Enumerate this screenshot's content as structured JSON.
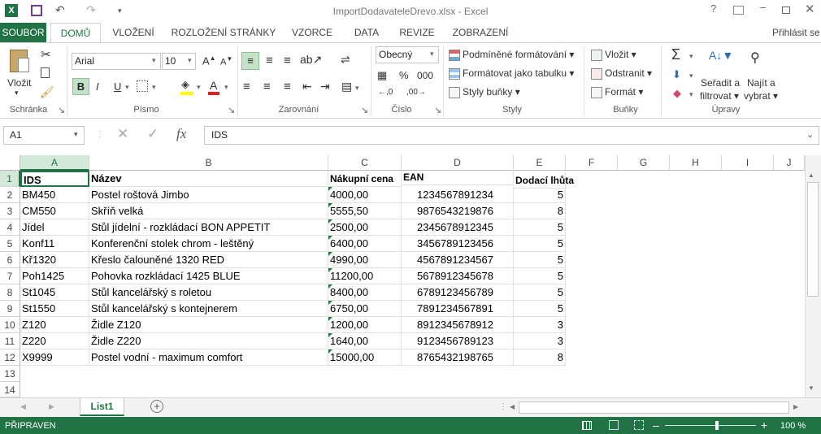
{
  "window": {
    "title": "ImportDodavateleDrevo.xlsx - Excel"
  },
  "qat": {
    "icons": [
      "excel-logo-icon",
      "save-icon",
      "undo-icon",
      "redo-icon",
      "customize-icon"
    ]
  },
  "win_controls": {
    "help": "?"
  },
  "tabs": [
    {
      "label": "SOUBOR"
    },
    {
      "label": "DOMŮ"
    },
    {
      "label": "VLOŽENÍ"
    },
    {
      "label": "ROZLOŽENÍ STRÁNKY"
    },
    {
      "label": "VZORCE"
    },
    {
      "label": "DATA"
    },
    {
      "label": "REVIZE"
    },
    {
      "label": "ZOBRAZENÍ"
    }
  ],
  "signin": "Přihlásit se",
  "ribbon": {
    "clipboard": {
      "paste": "Vložit",
      "label": "Schránka"
    },
    "font": {
      "name": "Arial",
      "size": "10",
      "label": "Písmo",
      "bold": "B",
      "italic": "I",
      "underline": "U"
    },
    "alignment": {
      "label": "Zarovnání"
    },
    "number": {
      "format": "Obecný",
      "label": "Číslo"
    },
    "styles": {
      "conditional": "Podmíněné formátování",
      "table": "Formátovat jako tabulku",
      "cell_styles": "Styly buňky",
      "label": "Styly"
    },
    "cells": {
      "insert": "Vložit",
      "delete": "Odstranit",
      "format": "Formát",
      "label": "Buňky"
    },
    "editing": {
      "sort": "Seřadit a",
      "sort2": "filtrovat",
      "find": "Najít a",
      "find2": "vybrat",
      "label": "Úpravy"
    }
  },
  "formula_bar": {
    "name_box": "A1",
    "value": "IDS",
    "fx": "fx"
  },
  "columns": [
    "A",
    "B",
    "C",
    "D",
    "E",
    "F",
    "G",
    "H",
    "I",
    "J"
  ],
  "headers": {
    "a": "IDS",
    "b": "Název",
    "c": "Nákupní cena",
    "d": "EAN",
    "e": "Dodací lhůta"
  },
  "rows": [
    {
      "n": "2",
      "a": "BM450",
      "b": "Postel roštová Jimbo",
      "c": "4000,00",
      "d": "1234567891234",
      "e": "5"
    },
    {
      "n": "3",
      "a": "CM550",
      "b": "Skříň velká",
      "c": "5555,50",
      "d": "9876543219876",
      "e": "8"
    },
    {
      "n": "4",
      "a": "Jídel",
      "b": "Stůl jídelní - rozkládací BON APPETIT",
      "c": "2500,00",
      "d": "2345678912345",
      "e": "5"
    },
    {
      "n": "5",
      "a": "Konf11",
      "b": "Konferenční stolek chrom - leštěný",
      "c": "6400,00",
      "d": "3456789123456",
      "e": "5"
    },
    {
      "n": "6",
      "a": "Kř1320",
      "b": "Křeslo čalouněné 1320 RED",
      "c": "4990,00",
      "d": "4567891234567",
      "e": "5"
    },
    {
      "n": "7",
      "a": "Poh1425",
      "b": "Pohovka rozkládací 1425 BLUE",
      "c": "11200,00",
      "d": "5678912345678",
      "e": "5"
    },
    {
      "n": "8",
      "a": "St1045",
      "b": "Stůl kancelářský s roletou",
      "c": "8400,00",
      "d": "6789123456789",
      "e": "5"
    },
    {
      "n": "9",
      "a": "St1550",
      "b": "Stůl kancelářský s kontejnerem",
      "c": "6750,00",
      "d": "7891234567891",
      "e": "5"
    },
    {
      "n": "10",
      "a": "Z120",
      "b": "Židle Z120",
      "c": "1200,00",
      "d": "8912345678912",
      "e": "3"
    },
    {
      "n": "11",
      "a": "Z220",
      "b": "Židle Z220",
      "c": "1640,00",
      "d": "9123456789123",
      "e": "3"
    },
    {
      "n": "12",
      "a": "X9999",
      "b": "Postel vodní - maximum comfort",
      "c": "15000,00",
      "d": "8765432198765",
      "e": "8"
    }
  ],
  "row_numbers": {
    "r1": "1",
    "r13": "13",
    "r14": "14"
  },
  "sheet": {
    "name": "List1"
  },
  "status": {
    "ready": "PŘIPRAVEN",
    "zoom": "100 %"
  }
}
